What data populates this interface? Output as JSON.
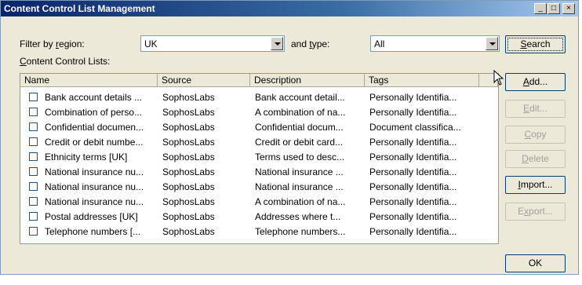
{
  "window": {
    "title": "Content Control List Management"
  },
  "titlebar_buttons": {
    "minimize": "_",
    "maximize": "□",
    "close": "×"
  },
  "filter": {
    "region_label_pre": "Filter by ",
    "region_label_mnemonic": "r",
    "region_label_post": "egion:",
    "region_value": "UK",
    "type_label_pre": "and ",
    "type_label_mnemonic": "t",
    "type_label_post": "ype:",
    "type_value": "All"
  },
  "list_label": {
    "mnemonic": "C",
    "rest": "ontent Control Lists:"
  },
  "columns": [
    "Name",
    "Source",
    "Description",
    "Tags"
  ],
  "rows": [
    {
      "name": "Bank account details ...",
      "source": "SophosLabs",
      "description": "Bank account detail...",
      "tags": "Personally Identifia..."
    },
    {
      "name": "Combination of perso...",
      "source": "SophosLabs",
      "description": "A combination of na...",
      "tags": "Personally Identifia..."
    },
    {
      "name": "Confidential documen...",
      "source": "SophosLabs",
      "description": "Confidential docum...",
      "tags": "Document classifica..."
    },
    {
      "name": "Credit or debit numbe...",
      "source": "SophosLabs",
      "description": "Credit or debit card...",
      "tags": "Personally Identifia..."
    },
    {
      "name": "Ethnicity terms [UK]",
      "source": "SophosLabs",
      "description": "Terms used to desc...",
      "tags": "Personally Identifia..."
    },
    {
      "name": "National insurance nu...",
      "source": "SophosLabs",
      "description": "National insurance ...",
      "tags": "Personally Identifia..."
    },
    {
      "name": "National insurance nu...",
      "source": "SophosLabs",
      "description": "National insurance ...",
      "tags": "Personally Identifia..."
    },
    {
      "name": "National insurance nu...",
      "source": "SophosLabs",
      "description": "A combination of na...",
      "tags": "Personally Identifia..."
    },
    {
      "name": "Postal addresses [UK]",
      "source": "SophosLabs",
      "description": "Addresses where t...",
      "tags": "Personally Identifia..."
    },
    {
      "name": "Telephone numbers [...",
      "source": "SophosLabs",
      "description": "Telephone numbers...",
      "tags": "Personally Identifia..."
    }
  ],
  "buttons": {
    "search": {
      "mnemonic": "S",
      "rest": "earch"
    },
    "add": {
      "mnemonic": "A",
      "rest": "dd..."
    },
    "edit": {
      "mnemonic": "E",
      "rest": "dit..."
    },
    "copy": {
      "mnemonic": "C",
      "rest": "opy"
    },
    "delete": {
      "mnemonic": "D",
      "rest": "elete"
    },
    "import": {
      "mnemonic": "I",
      "rest": "mport..."
    },
    "export": {
      "pre": "E",
      "mnemonic": "x",
      "rest": "port..."
    },
    "ok": "OK"
  },
  "colors": {
    "title_start": "#0a246a",
    "title_end": "#a6caf0",
    "dialog_bg": "#ece9d8",
    "disabled_text": "#a0a0a0"
  }
}
